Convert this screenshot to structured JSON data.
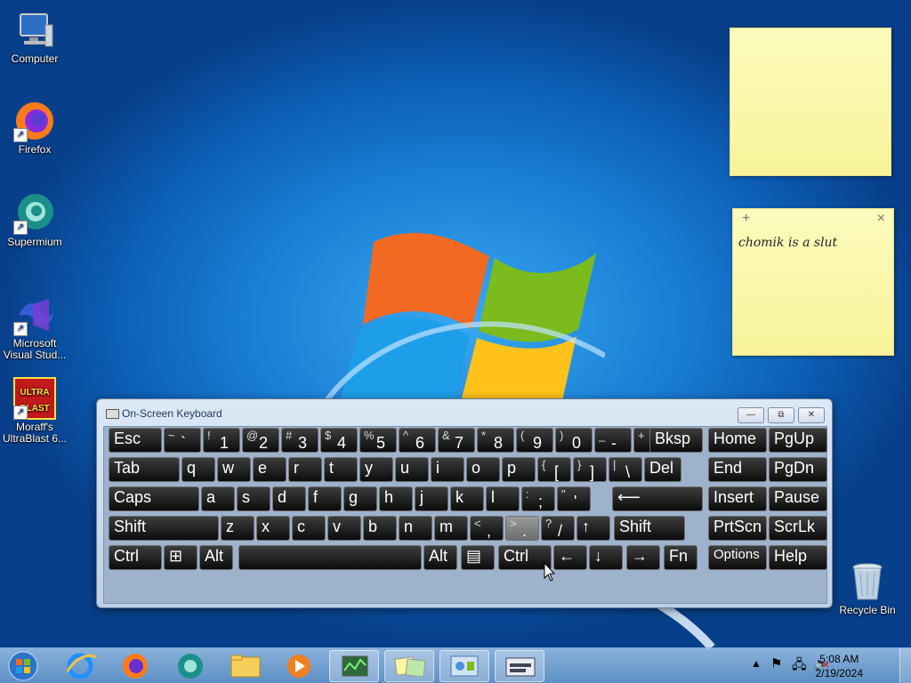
{
  "desktop_icons": [
    {
      "name": "computer-icon",
      "label": "Computer"
    },
    {
      "name": "firefox-icon",
      "label": "Firefox"
    },
    {
      "name": "supermium-icon",
      "label": "Supermium"
    },
    {
      "name": "visual-studio-icon",
      "label": "Microsoft Visual Stud..."
    },
    {
      "name": "ultrablast-icon",
      "label": "Moraff's UltraBlast 6...",
      "logo_text": "ULTRA BLAST"
    }
  ],
  "recycle_bin": {
    "label": "Recycle Bin"
  },
  "sticky_notes": [
    {
      "text": ""
    },
    {
      "add_glyph": "+",
      "close_glyph": "×",
      "text": "chomik is a slut"
    }
  ],
  "osk": {
    "title": "On-Screen Keyboard",
    "minimize_glyph": "—",
    "restore_glyph": "⧉",
    "close_glyph": "✕",
    "rows": [
      [
        {
          "main": "Esc"
        },
        {
          "shift": "~",
          "low": "`"
        },
        {
          "shift": "!",
          "low": "1"
        },
        {
          "shift": "@",
          "low": "2"
        },
        {
          "shift": "#",
          "low": "3"
        },
        {
          "shift": "$",
          "low": "4"
        },
        {
          "shift": "%",
          "low": "5"
        },
        {
          "shift": "^",
          "low": "6"
        },
        {
          "shift": "&",
          "low": "7"
        },
        {
          "shift": "*",
          "low": "8"
        },
        {
          "shift": "(",
          "low": "9"
        },
        {
          "shift": ")",
          "low": "0"
        },
        {
          "shift": "_",
          "low": "-"
        },
        {
          "shift": "+",
          "low": "="
        },
        {
          "main": "Bksp"
        },
        {
          "main": "Home"
        },
        {
          "main": "PgUp"
        }
      ],
      [
        {
          "main": "Tab"
        },
        {
          "main": "q"
        },
        {
          "main": "w"
        },
        {
          "main": "e"
        },
        {
          "main": "r"
        },
        {
          "main": "t"
        },
        {
          "main": "y"
        },
        {
          "main": "u"
        },
        {
          "main": "i"
        },
        {
          "main": "o"
        },
        {
          "main": "p"
        },
        {
          "shift": "{",
          "low": "["
        },
        {
          "shift": "}",
          "low": "]"
        },
        {
          "shift": "|",
          "low": "\\"
        },
        {
          "main": "Del"
        },
        {
          "main": "End"
        },
        {
          "main": "PgDn"
        }
      ],
      [
        {
          "main": "Caps"
        },
        {
          "main": "a"
        },
        {
          "main": "s"
        },
        {
          "main": "d"
        },
        {
          "main": "f"
        },
        {
          "main": "g"
        },
        {
          "main": "h"
        },
        {
          "main": "j"
        },
        {
          "main": "k"
        },
        {
          "main": "l"
        },
        {
          "shift": ":",
          "low": ";"
        },
        {
          "shift": "\"",
          "low": "'"
        },
        {
          "main": "⟵"
        },
        {
          "main": "Insert"
        },
        {
          "main": "Pause"
        }
      ],
      [
        {
          "main": "Shift"
        },
        {
          "main": "z"
        },
        {
          "main": "x"
        },
        {
          "main": "c"
        },
        {
          "main": "v"
        },
        {
          "main": "b"
        },
        {
          "main": "n"
        },
        {
          "main": "m"
        },
        {
          "shift": "<",
          "low": ","
        },
        {
          "shift": ">",
          "low": ".",
          "pressed": true
        },
        {
          "shift": "?",
          "low": "/"
        },
        {
          "main": "↑"
        },
        {
          "main": "Shift"
        },
        {
          "main": "PrtScn"
        },
        {
          "main": "ScrLk"
        }
      ],
      [
        {
          "main": "Ctrl"
        },
        {
          "main": "⊞"
        },
        {
          "main": "Alt"
        },
        {
          "main": ""
        },
        {
          "main": "Alt"
        },
        {
          "main": "▤"
        },
        {
          "main": "Ctrl"
        },
        {
          "main": "←"
        },
        {
          "main": "↓"
        },
        {
          "main": "→"
        },
        {
          "main": "Fn"
        },
        {
          "main": "Options"
        },
        {
          "main": "Help"
        }
      ]
    ]
  },
  "taskbar": {
    "items": [
      {
        "name": "start-button",
        "open": false
      },
      {
        "name": "taskbar-internet-explorer",
        "open": false
      },
      {
        "name": "taskbar-firefox",
        "open": false
      },
      {
        "name": "taskbar-supermium",
        "open": false
      },
      {
        "name": "taskbar-explorer",
        "open": false
      },
      {
        "name": "taskbar-media-player",
        "open": false
      },
      {
        "name": "taskbar-task-manager",
        "open": true
      },
      {
        "name": "taskbar-sticky-notes",
        "open": true
      },
      {
        "name": "taskbar-control-panel",
        "open": true
      },
      {
        "name": "taskbar-on-screen-keyboard",
        "open": true
      }
    ],
    "tray": {
      "time": "5:08 AM",
      "date": "2/19/2024"
    }
  }
}
